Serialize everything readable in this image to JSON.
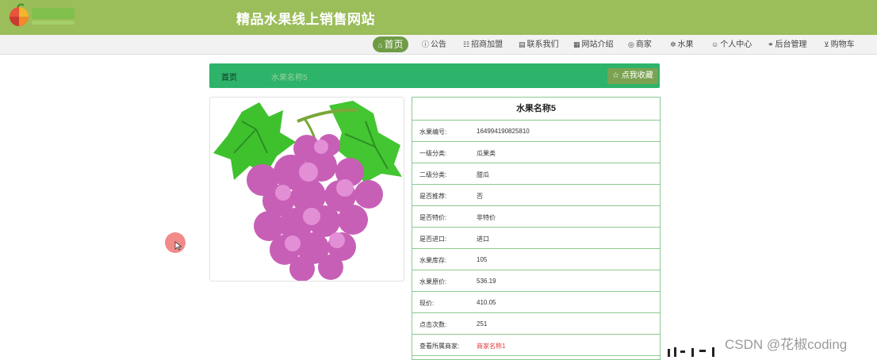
{
  "header": {
    "site_title": "精品水果线上销售网站",
    "logo_icon": "fruit-logo-icon",
    "background": "#9bbd5a"
  },
  "nav": {
    "items": [
      {
        "icon": "home-icon",
        "label": "首页",
        "active": true
      },
      {
        "icon": "notice-icon",
        "label": "公告"
      },
      {
        "icon": "join-icon",
        "label": "招商加盟"
      },
      {
        "icon": "contact-icon",
        "label": "联系我们"
      },
      {
        "icon": "site-intro-icon",
        "label": "网站介绍"
      },
      {
        "icon": "merchant-icon",
        "label": "商家"
      },
      {
        "icon": "fruit-icon",
        "label": "水果"
      },
      {
        "icon": "user-icon",
        "label": "个人中心"
      },
      {
        "icon": "link-icon",
        "label": "后台管理"
      },
      {
        "icon": "cart-icon",
        "label": "购物车"
      }
    ]
  },
  "breadcrumb": {
    "home": "首页",
    "current": "水果名称5",
    "favorite_label": "点我收藏",
    "favorite_icon": "star-icon",
    "color": "#2eb36a"
  },
  "product": {
    "image_icon": "grapes-image",
    "title": "水果名称5",
    "rows": [
      {
        "label": "水果编号:",
        "value": "164994190825810"
      },
      {
        "label": "一级分类:",
        "value": "瓜果类"
      },
      {
        "label": "二级分类:",
        "value": "甜瓜"
      },
      {
        "label": "是否推荐:",
        "value": "否"
      },
      {
        "label": "是否特价:",
        "value": "非特价"
      },
      {
        "label": "是否进口:",
        "value": "进口"
      },
      {
        "label": "水果库存:",
        "value": "105"
      },
      {
        "label": "水果原价:",
        "value": "536.19"
      },
      {
        "label": "现价:",
        "value": "410.05"
      },
      {
        "label": "点击次数:",
        "value": "251"
      },
      {
        "label": "查看所属商家:",
        "value": "商家名称1",
        "link": true
      }
    ]
  },
  "watermark": {
    "text": "CSDN @花椒coding"
  }
}
